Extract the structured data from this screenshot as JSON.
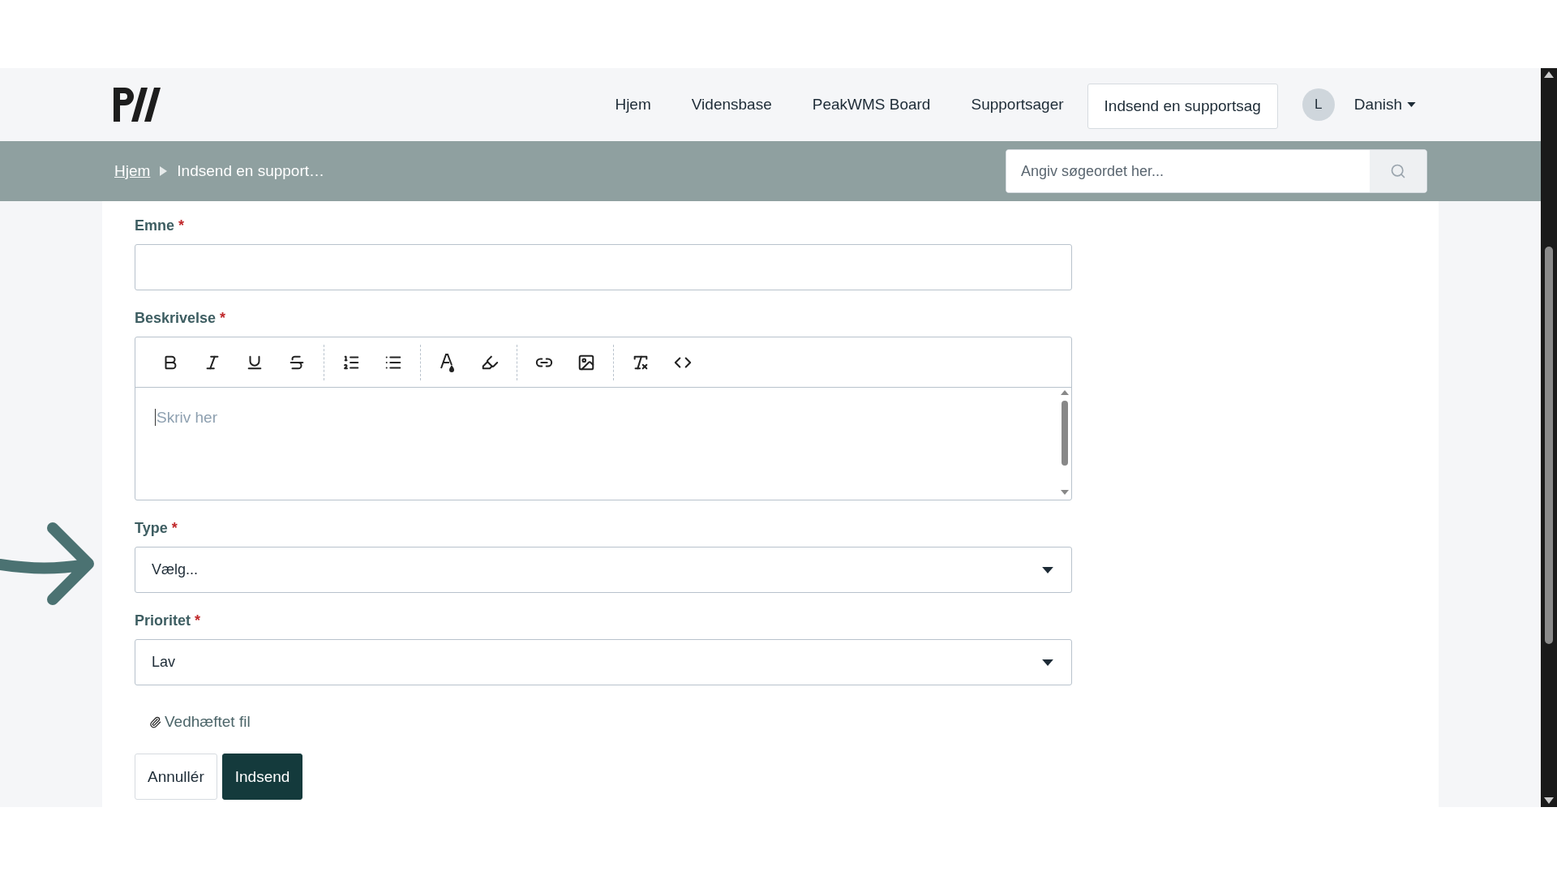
{
  "nav": {
    "items": [
      {
        "label": "Hjem",
        "selected": false
      },
      {
        "label": "Vidensbase",
        "selected": false
      },
      {
        "label": "PeakWMS Board",
        "selected": false
      },
      {
        "label": "Supportsager",
        "selected": false
      },
      {
        "label": "Indsend en supportsag",
        "selected": true
      }
    ],
    "user": {
      "initial": "L",
      "language": "Danish"
    }
  },
  "breadcrumb": [
    {
      "label": "Hjem",
      "kind": "link"
    },
    {
      "label": "Indsend en support…",
      "kind": "current"
    }
  ],
  "search": {
    "placeholder": "Angiv søgeordet her..."
  },
  "form": {
    "fields": [
      {
        "kind": "text",
        "label": "Emne",
        "required_mark": "*"
      },
      {
        "kind": "editor",
        "label": "Beskrivelse",
        "required_mark": "*",
        "placeholder": "Skriv her"
      },
      {
        "kind": "select",
        "label": "Type",
        "required_mark": "*",
        "value": "Vælg..."
      },
      {
        "kind": "select",
        "label": "Prioritet",
        "required_mark": "*",
        "value": "Lav"
      }
    ],
    "attachment": "Vedhæftet fil",
    "buttons": [
      {
        "label": "Annullér",
        "kind": "secondary"
      },
      {
        "label": "Indsend",
        "kind": "primary"
      }
    ]
  }
}
